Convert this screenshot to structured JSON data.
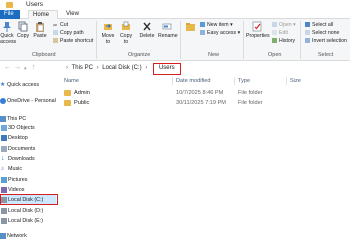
{
  "window": {
    "title": "Users"
  },
  "tabs": [
    "File",
    "Home",
    "Share",
    "View"
  ],
  "ribbon": {
    "clipboard": {
      "label": "Clipboard",
      "quick_access": "Quick access",
      "copy": "Copy",
      "paste": "Paste",
      "cut": "Cut",
      "copy_path": "Copy path",
      "paste_shortcut": "Paste shortcut"
    },
    "organize": {
      "label": "Organize",
      "move_to": "Move to",
      "copy_to": "Copy to",
      "delete": "Delete",
      "rename": "Rename"
    },
    "new": {
      "label": "New",
      "new_item": "New item",
      "easy_access": "Easy access",
      "new_folder": "New folder"
    },
    "open": {
      "label": "Open",
      "properties": "Properties",
      "open": "Open",
      "edit": "Edit",
      "history": "History"
    },
    "select": {
      "label": "Select",
      "select_all": "Select all",
      "select_none": "Select none",
      "invert_selection": "Invert selection"
    }
  },
  "address": {
    "crumbs": [
      "This PC",
      "Local Disk (C:)"
    ],
    "current": "Users"
  },
  "sidebar": [
    {
      "label": "Quick access",
      "icon": "star-icon"
    },
    {
      "label": "OneDrive - Personal",
      "icon": "cloud-icon"
    },
    {
      "label": "This PC",
      "icon": "computer-icon"
    },
    {
      "label": "3D Objects",
      "icon": "cube-icon"
    },
    {
      "label": "Desktop",
      "icon": "desktop-icon"
    },
    {
      "label": "Documents",
      "icon": "documents-icon"
    },
    {
      "label": "Downloads",
      "icon": "download-icon"
    },
    {
      "label": "Music",
      "icon": "music-icon"
    },
    {
      "label": "Pictures",
      "icon": "pictures-icon"
    },
    {
      "label": "Videos",
      "icon": "videos-icon"
    },
    {
      "label": "Local Disk (C:)",
      "icon": "drive-icon"
    },
    {
      "label": "Local Disk (D:)",
      "icon": "drive-icon"
    },
    {
      "label": "Local Disk (E:)",
      "icon": "drive-icon"
    },
    {
      "label": "Network",
      "icon": "network-icon"
    }
  ],
  "columns": [
    "Name",
    "Date modified",
    "Type",
    "Size"
  ],
  "files": [
    {
      "name": "Admin",
      "date": "10/7/2025 8:46 PM",
      "type": "File folder"
    },
    {
      "name": "Public",
      "date": "30/11/2025 7:19 PM",
      "type": "File folder"
    }
  ],
  "colors": {
    "accent": "#1c6dbf",
    "highlight": "#d62020",
    "folder": "#e8b84a"
  }
}
